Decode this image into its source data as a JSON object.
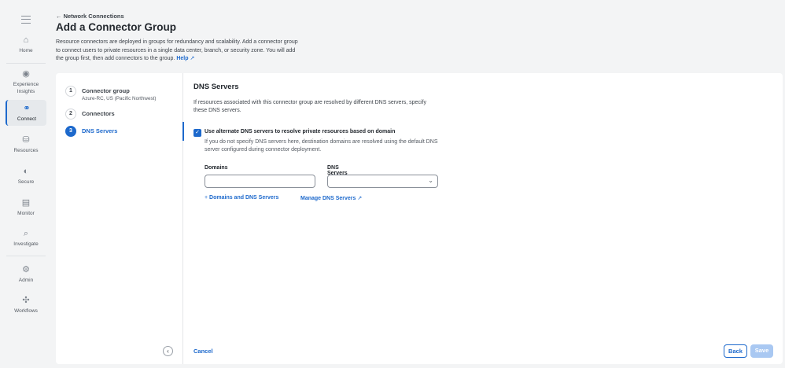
{
  "sidebar": {
    "items": [
      {
        "label": "Home",
        "icon": "home-icon"
      },
      {
        "label": "Experience Insights",
        "icon": "insights-icon"
      },
      {
        "label": "Connect",
        "icon": "connect-icon",
        "active": true
      },
      {
        "label": "Resources",
        "icon": "resources-icon"
      },
      {
        "label": "Secure",
        "icon": "shield-icon"
      },
      {
        "label": "Monitor",
        "icon": "monitor-icon"
      },
      {
        "label": "Investigate",
        "icon": "investigate-icon"
      },
      {
        "label": "Admin",
        "icon": "admin-icon"
      },
      {
        "label": "Workflows",
        "icon": "workflows-icon"
      }
    ]
  },
  "header": {
    "back_label": "Network Connections",
    "title": "Add a Connector Group",
    "description": "Resource connectors are deployed in groups for redundancy and scalability. Add a connector group to connect users to private resources in a single data center, branch, or security zone. You will add the group first, then add connectors to the group.",
    "help_label": "Help"
  },
  "steps": [
    {
      "num": "1",
      "label": "Connector group",
      "sub": "Azure-RC, US (Pacific Northwest)"
    },
    {
      "num": "2",
      "label": "Connectors"
    },
    {
      "num": "3",
      "label": "DNS Servers",
      "active": true
    }
  ],
  "dns": {
    "title": "DNS Servers",
    "description": "If resources associated with this connector group are resolved by different DNS servers, specify these DNS servers.",
    "checkbox_label": "Use alternate DNS servers to resolve private resources based on domain",
    "checkbox_checked": true,
    "checkbox_help": "If you do not specify DNS servers here, destination domains are resolved using the default DNS server configured during connector deployment.",
    "domains_label": "Domains",
    "domains_value": "",
    "dns_servers_label": "DNS Servers",
    "dns_servers_value": "",
    "add_link": "Domains and DNS Servers",
    "manage_link": "Manage DNS Servers"
  },
  "footer": {
    "cancel": "Cancel",
    "back": "Back",
    "save": "Save"
  },
  "colors": {
    "accent": "#1d69cc"
  }
}
